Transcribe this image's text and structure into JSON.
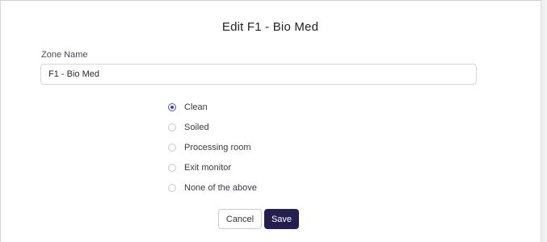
{
  "dialog": {
    "title": "Edit F1 - Bio Med"
  },
  "zone_name": {
    "label": "Zone Name",
    "value": "F1 - Bio Med"
  },
  "zone_type": {
    "selected": "Clean",
    "options": [
      {
        "label": "Clean",
        "checked": true
      },
      {
        "label": "Soiled",
        "checked": false
      },
      {
        "label": "Processing room",
        "checked": false
      },
      {
        "label": "Exit monitor",
        "checked": false
      },
      {
        "label": "None of the above",
        "checked": false
      }
    ]
  },
  "actions": {
    "cancel_label": "Cancel",
    "save_label": "Save"
  },
  "colors": {
    "primary": "#23204f",
    "radio_accent": "#3b3bcc"
  }
}
